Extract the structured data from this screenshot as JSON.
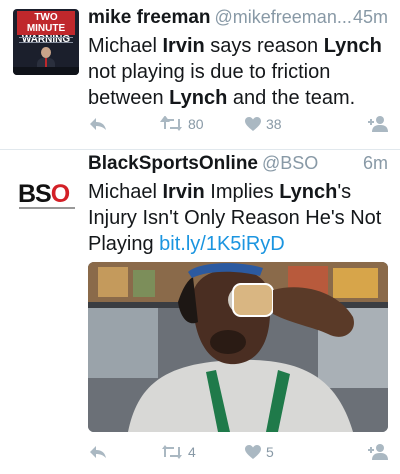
{
  "tweets": [
    {
      "author_name": "mike freeman",
      "handle": "@mikefreeman...",
      "time": "45m",
      "avatar": {
        "icon": "tv-show-avatar-icon",
        "banner_text": "TWO MINUTE WARNING"
      },
      "text_parts": [
        "Michael ",
        "Irvin",
        " says reason ",
        "Lynch",
        " not playing is due to friction between ",
        "Lynch",
        " and the team."
      ],
      "retweets": "80",
      "likes": "38"
    },
    {
      "author_name": "BlackSportsOnline",
      "handle": "@BSO",
      "time": "6m",
      "avatar": {
        "icon": "bso-logo-icon",
        "logo_text": "BSO"
      },
      "text_parts": [
        "Michael ",
        "Irvin",
        " Implies ",
        "Lynch",
        "'s Injury Isn't Only Reason He's Not Playing "
      ],
      "link": "bit.ly/1K5iRyD",
      "media": {
        "icon": "photo-man-drinking-icon"
      },
      "retweets": "4",
      "likes": "5"
    }
  ],
  "colors": {
    "text": "#14171a",
    "secondary": "#8899a6",
    "link": "#1b95e0",
    "icon": "#aab8c2",
    "divider": "#e1e8ed"
  }
}
